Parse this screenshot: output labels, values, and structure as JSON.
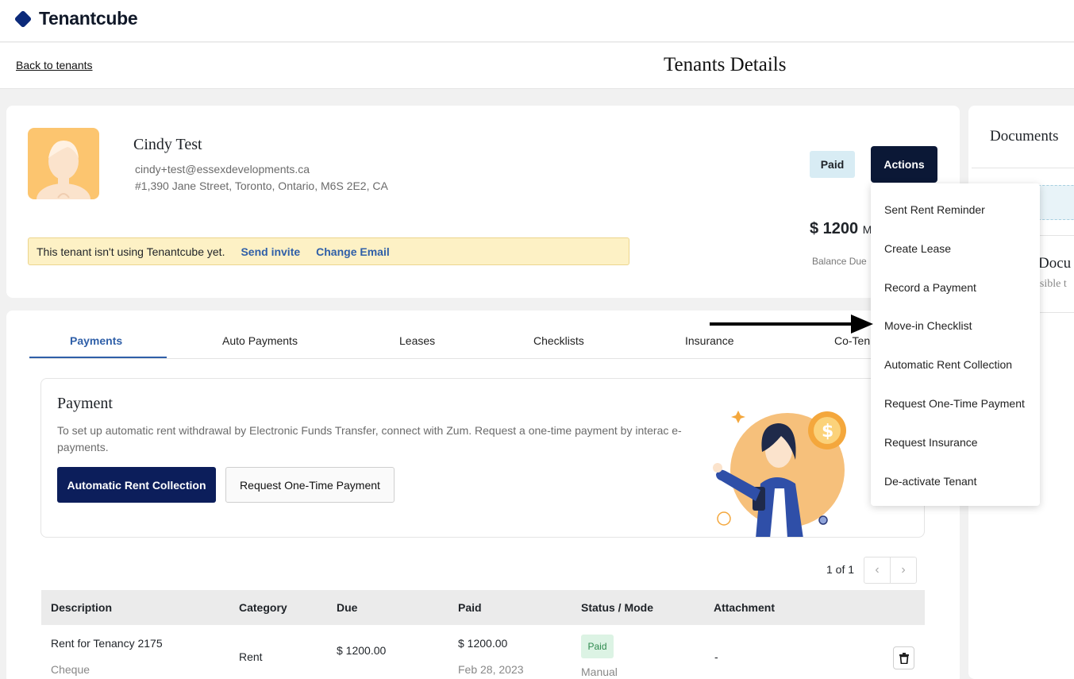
{
  "app": {
    "name": "Tenantcube"
  },
  "nav": {
    "back_label": "Back to tenants",
    "page_title": "Tenants Details"
  },
  "tenant": {
    "name": "Cindy Test",
    "email": "cindy+test@essexdevelopments.ca",
    "address": "#1,390 Jane Street, Toronto, Ontario, M6S 2E2, CA",
    "status": "Paid",
    "actions_label": "Actions",
    "balance_amount": "$ 1200",
    "balance_suffix": "M",
    "balance_label": "Balance Due"
  },
  "invite_banner": {
    "text": "This tenant isn't using Tenantcube yet.",
    "send_invite": "Send invite",
    "change_email": "Change Email"
  },
  "documents": {
    "title": "Documents",
    "sub_title": "Docu",
    "sub_text": "isible t"
  },
  "tabs": [
    "Payments",
    "Auto Payments",
    "Leases",
    "Checklists",
    "Insurance",
    "Co-Ten"
  ],
  "payment": {
    "title": "Payment",
    "description": "To set up automatic rent withdrawal by Electronic Funds Transfer, connect with Zum. Request a one-time payment by interac e-payments.",
    "primary_button": "Automatic Rent Collection",
    "secondary_button": "Request One-Time Payment"
  },
  "pagination": {
    "text": "1 of 1"
  },
  "table": {
    "headers": [
      "Description",
      "Category",
      "Due",
      "Paid",
      "Status / Mode",
      "Attachment"
    ],
    "rows": [
      {
        "description": "Rent for Tenancy 2175",
        "method": "Cheque",
        "category": "Rent",
        "due": "$ 1200.00",
        "paid": "$ 1200.00",
        "paid_date": "Feb 28, 2023",
        "status": "Paid",
        "mode": "Manual",
        "attachment": "-"
      }
    ]
  },
  "actions_menu": [
    "Sent Rent Reminder",
    "Create Lease",
    "Record a Payment",
    "Move-in Checklist",
    "Automatic Rent Collection",
    "Request One-Time Payment",
    "Request Insurance",
    "De-activate Tenant"
  ],
  "colors": {
    "brand_navy": "#0c1e5b",
    "accent_blue": "#2f5fa8",
    "banner_yellow": "#fdf1c5",
    "paid_green": "#dcf3e4"
  },
  "icons": [
    "tenantcube-logo-icon",
    "user-avatar-icon",
    "chevron-left-icon",
    "chevron-right-icon",
    "trash-icon",
    "arrow-right-icon"
  ]
}
